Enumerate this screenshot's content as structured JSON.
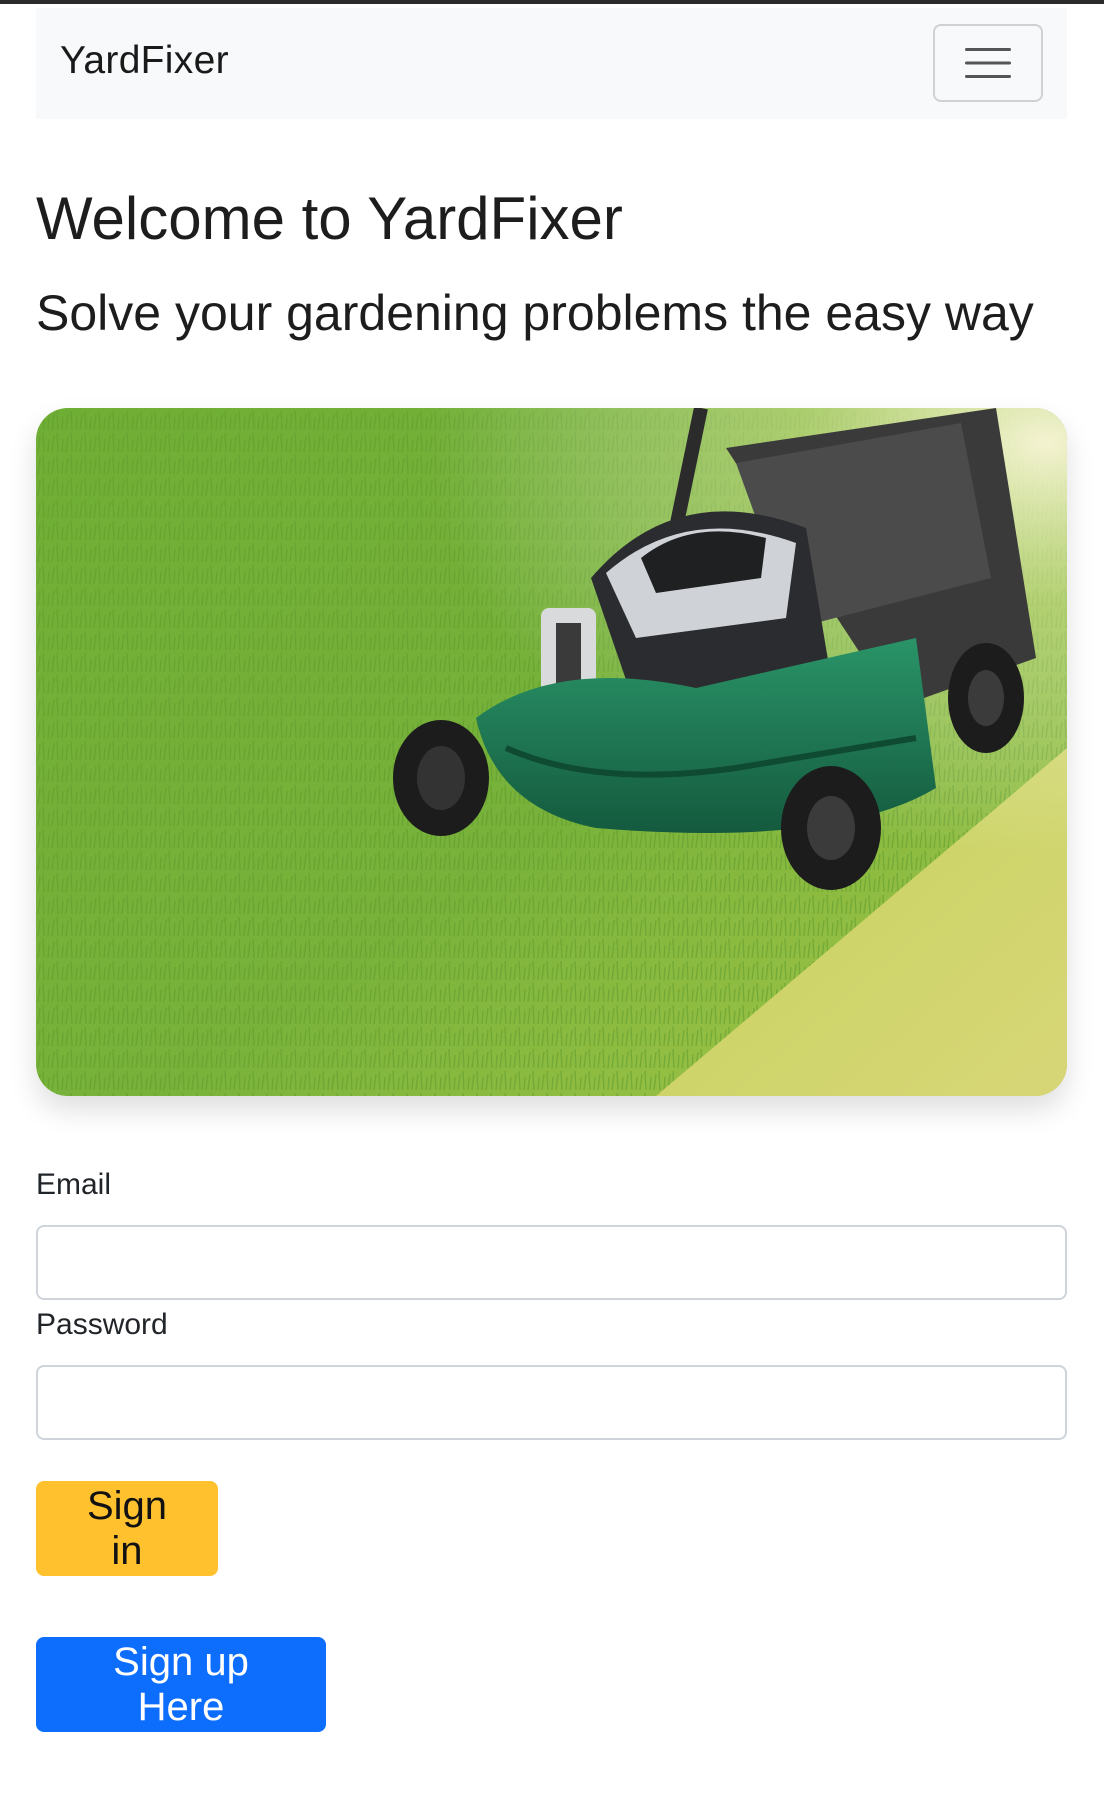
{
  "navbar": {
    "brand": "YardFixer",
    "menu_icon": "hamburger-menu-icon"
  },
  "header": {
    "title": "Welcome to YardFixer",
    "subtitle": "Solve your gardening problems the easy way"
  },
  "hero": {
    "subject": "lawn-mower-on-grass",
    "colors": {
      "grass": "#8fbf3f",
      "mower_body": "#1f7a55",
      "engine": "#2e2e30",
      "sunlight": "#f4f0c0"
    }
  },
  "login_form": {
    "email_label": "Email",
    "email_value": "",
    "email_placeholder": "",
    "password_label": "Password",
    "password_value": "",
    "password_placeholder": ""
  },
  "actions": {
    "signin_label": "Sign in",
    "signup_label": "Sign up Here"
  },
  "colors": {
    "navbar_bg": "#f8f9fa",
    "signin_button": "#ffc12e",
    "signup_button": "#0d6efd"
  }
}
